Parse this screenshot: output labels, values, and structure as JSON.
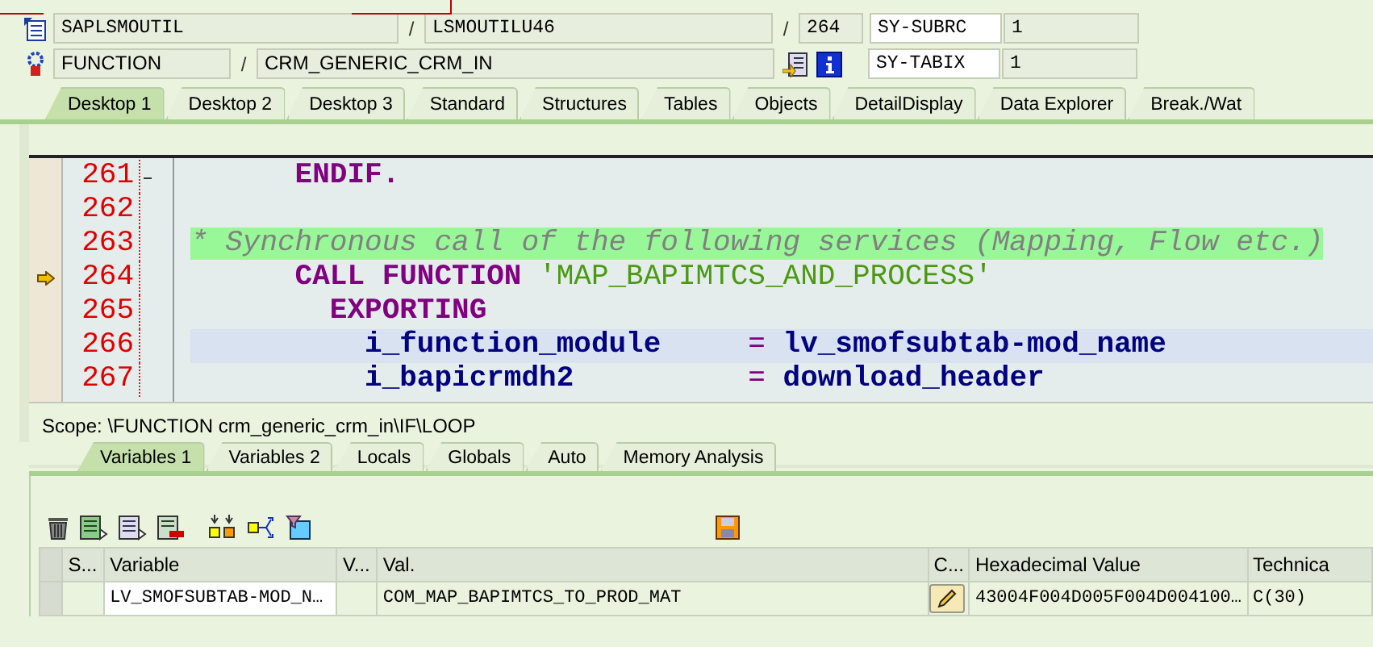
{
  "header": {
    "program": "SAPLSMOUTIL",
    "include": "LSMOUTILU46",
    "line": "264",
    "event_type": "FUNCTION",
    "event": "CRM_GENERIC_CRM_IN",
    "separators": [
      "/",
      "/",
      "/"
    ],
    "system_fields": [
      {
        "name": "SY-SUBRC",
        "value": "1"
      },
      {
        "name": "SY-TABIX",
        "value": "1"
      }
    ]
  },
  "desktop_tabs": [
    {
      "label": "Desktop 1",
      "selected": true
    },
    {
      "label": "Desktop 2",
      "selected": false
    },
    {
      "label": "Desktop 3",
      "selected": false
    },
    {
      "label": "Standard",
      "selected": false
    },
    {
      "label": "Structures",
      "selected": false
    },
    {
      "label": "Tables",
      "selected": false
    },
    {
      "label": "Objects",
      "selected": false
    },
    {
      "label": "DetailDisplay",
      "selected": false
    },
    {
      "label": "Data Explorer",
      "selected": false
    },
    {
      "label": "Break./Wat",
      "selected": false
    }
  ],
  "code_lines": [
    {
      "number": "261",
      "current": false,
      "highlighted": false,
      "block_end": true,
      "tokens": [
        {
          "kind": "keyword",
          "text": "      ENDIF."
        }
      ]
    },
    {
      "number": "262",
      "current": false,
      "highlighted": false,
      "block_end": false
    },
    {
      "number": "263",
      "current": false,
      "highlighted": false,
      "block_end": false,
      "tokens": [
        {
          "kind": "comment",
          "text": "* Synchronous call of the following services (Mapping, Flow etc.)"
        }
      ]
    },
    {
      "number": "264",
      "current": true,
      "highlighted": false,
      "block_end": false,
      "tokens": [
        {
          "kind": "keyword",
          "text": "      CALL FUNCTION"
        },
        {
          "kind": "string",
          "text": " 'MAP_BAPIMTCS_AND_PROCESS'"
        }
      ]
    },
    {
      "number": "265",
      "current": false,
      "highlighted": false,
      "block_end": false,
      "tokens": [
        {
          "kind": "keyword",
          "text": "        EXPORTING"
        }
      ]
    },
    {
      "number": "266",
      "current": false,
      "highlighted": true,
      "block_end": false,
      "tokens": [
        {
          "kind": "variable",
          "text": "          i_function_module"
        },
        {
          "kind": "operator",
          "text": "     ="
        },
        {
          "kind": "variable",
          "text": " lv_smofsubtab-mod_name"
        }
      ]
    },
    {
      "number": "267",
      "current": false,
      "highlighted": false,
      "block_end": false,
      "tokens": [
        {
          "kind": "variable",
          "text": "          i_bapicrmdh2"
        },
        {
          "kind": "operator",
          "text": "          ="
        },
        {
          "kind": "variable",
          "text": " download_header"
        }
      ]
    }
  ],
  "scope": "Scope: \\FUNCTION crm_generic_crm_in\\IF\\LOOP",
  "variable_tabs": [
    {
      "label": "Variables 1",
      "selected": true
    },
    {
      "label": "Variables 2",
      "selected": false
    },
    {
      "label": "Locals",
      "selected": false
    },
    {
      "label": "Globals",
      "selected": false
    },
    {
      "label": "Auto",
      "selected": false
    },
    {
      "label": "Memory Analysis",
      "selected": false
    }
  ],
  "table": {
    "columns": [
      "S...",
      "Variable",
      "V...",
      "Val.",
      "C...",
      "Hexadecimal Value",
      "Technica"
    ],
    "rows": [
      {
        "variable": "LV_SMOFSUBTAB-MOD_N…",
        "value": "COM_MAP_BAPIMTCS_TO_PROD_MAT",
        "hex": "43004F004D005F004D004100…",
        "technical_type": "C(30)"
      }
    ]
  }
}
